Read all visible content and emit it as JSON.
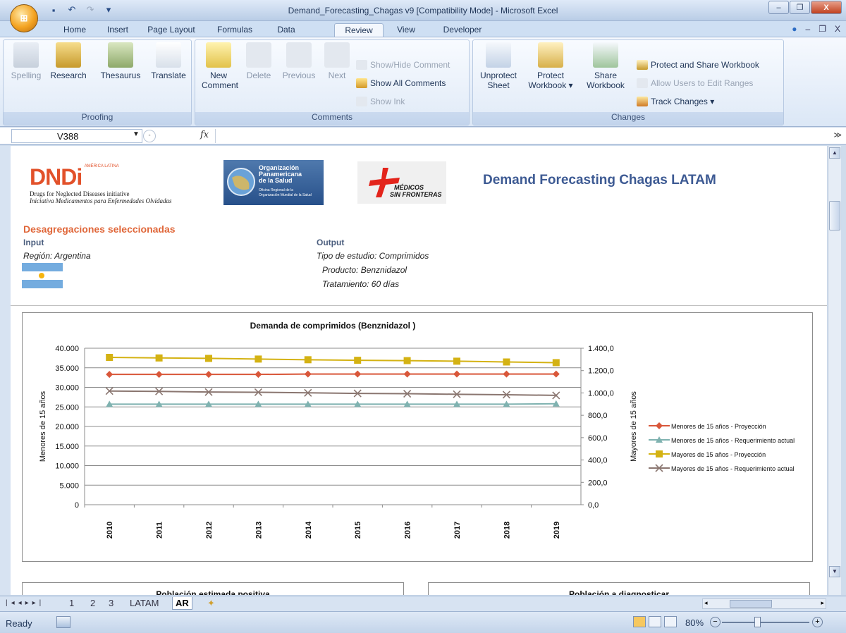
{
  "window": {
    "title": "Demand_Forecasting_Chagas v9  [Compatibility Mode] - Microsoft Excel",
    "minimize": "–",
    "restore": "❐",
    "close": "X"
  },
  "ribbon_tabs": [
    "Home",
    "Insert",
    "Page Layout",
    "Formulas",
    "Data",
    "Review",
    "View",
    "Developer"
  ],
  "active_tab": "Review",
  "ribbon": {
    "proofing": {
      "label": "Proofing",
      "buttons": [
        "Spelling",
        "Research",
        "Thesaurus",
        "Translate"
      ]
    },
    "comments": {
      "label": "Comments",
      "new": "New Comment",
      "delete": "Delete",
      "previous": "Previous",
      "next": "Next",
      "show_hide": "Show/Hide Comment",
      "show_all": "Show All Comments",
      "show_ink": "Show Ink"
    },
    "changes": {
      "label": "Changes",
      "unprotect_sheet": "Unprotect Sheet",
      "protect_workbook": "Protect Workbook ▾",
      "share_workbook": "Share Workbook",
      "protect_share": "Protect and Share Workbook",
      "allow_edit": "Allow Users to Edit Ranges",
      "track": "Track Changes ▾"
    }
  },
  "formula_bar": {
    "name_box": "V388",
    "fx": "fx",
    "value": ""
  },
  "sheet": {
    "logos": {
      "dndi": "DNDi",
      "dndi_small": "AMÉRICA LATINA",
      "dndi_line1": "Drugs for Neglected Diseases initiative",
      "dndi_line2": "Iniciativa Medicamentos para Enfermedades Olvidadas",
      "ops_line1": "Organización",
      "ops_line2": "Panamericana",
      "ops_line3": "de la Salud",
      "ops_line4": "Oficina Regional de la",
      "ops_line5": "Organización Mundial de la Salud",
      "msf_line1": "MÉDICOS",
      "msf_line2": "SIN FRONTERAS"
    },
    "title": "Demand Forecasting Chagas LATAM",
    "section": "Desagregaciones seleccionadas",
    "input_label": "Input",
    "region": "Región: Argentina",
    "output_label": "Output",
    "tipo": "Tipo de estudio: Comprimidos",
    "producto": "Producto: Benznidazol",
    "tratamiento": "Tratamiento: 60 días",
    "chart2_title": "Población estimada positiva",
    "chart3_title": "Población a diagnosticar"
  },
  "sheet_tabs": [
    "1",
    "2",
    "3",
    "LATAM",
    "AR"
  ],
  "active_sheet": "AR",
  "status": {
    "ready": "Ready",
    "zoom": "80%"
  },
  "chart_data": {
    "type": "line",
    "title": "Demanda de comprimidos (Benznidazol )",
    "xlabel": "",
    "ylabel": "Menores de 15 años",
    "y2label": "Mayores de 15 años",
    "categories": [
      "2010",
      "2011",
      "2012",
      "2013",
      "2014",
      "2015",
      "2016",
      "2017",
      "2018",
      "2019"
    ],
    "ylim": [
      0,
      40000
    ],
    "y2lim": [
      0,
      1400
    ],
    "y_ticks": [
      "0",
      "5.000",
      "10.000",
      "15.000",
      "20.000",
      "25.000",
      "30.000",
      "35.000",
      "40.000"
    ],
    "y2_ticks": [
      "0,0",
      "200,0",
      "400,0",
      "600,0",
      "800,0",
      "1.000,0",
      "1.200,0",
      "1.400,0"
    ],
    "legend_position": "right",
    "grid": true,
    "series": [
      {
        "name": "Menores de 15 años - Proyección",
        "axis": "left",
        "color": "#d9573a",
        "marker": "diamond",
        "values": [
          33300,
          33300,
          33300,
          33300,
          33400,
          33400,
          33400,
          33400,
          33400,
          33400
        ]
      },
      {
        "name": "Menores de 15 años - Requerimiento actual",
        "axis": "left",
        "color": "#7fb2b0",
        "marker": "triangle",
        "values": [
          25700,
          25700,
          25700,
          25700,
          25700,
          25700,
          25700,
          25700,
          25700,
          25800
        ]
      },
      {
        "name": "Mayores de 15 años - Proyección",
        "axis": "right",
        "color": "#d4b213",
        "marker": "square",
        "values": [
          1318,
          1313,
          1309,
          1303,
          1297,
          1292,
          1289,
          1284,
          1277,
          1271
        ]
      },
      {
        "name": "Mayores de 15 años - Requerimiento actual",
        "axis": "right",
        "color": "#8a7670",
        "marker": "x",
        "values": [
          1017,
          1014,
          1008,
          1006,
          1001,
          996,
          993,
          988,
          984,
          978
        ]
      }
    ]
  }
}
